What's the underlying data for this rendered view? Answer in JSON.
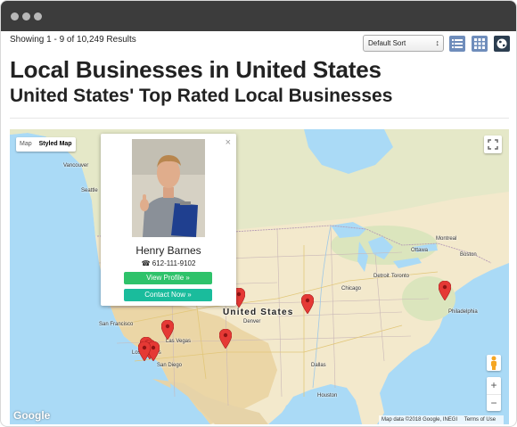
{
  "window": {
    "title_bar_dots": 3
  },
  "toolbar": {
    "results_text": "Showing 1 - 9 of 10,249 Results",
    "sort_selected": "Default Sort",
    "view_buttons": [
      "list-view",
      "grid-view",
      "map-view"
    ]
  },
  "header": {
    "title": "Local Businesses in United States",
    "subtitle": "United States' Top Rated Local Businesses"
  },
  "map": {
    "type_controls": [
      "Map",
      "Styled Map"
    ],
    "active_type": "Styled Map",
    "country_label": "United States",
    "cities": [
      "Seattle",
      "Vancouver",
      "Montreal",
      "Ottawa",
      "Toronto",
      "Boston",
      "Chicago",
      "Detroit",
      "Philadelphia",
      "San Francisco",
      "Las Vegas",
      "Los Angeles",
      "San Diego",
      "Denver",
      "Dallas",
      "Houston"
    ],
    "logo": "Google",
    "attribution": "Map data ©2018 Google, INEGI",
    "terms": "Terms of Use",
    "zoom_in": "+",
    "zoom_out": "−",
    "colors": {
      "water": "#aadaf6",
      "land": "#f5ecd4",
      "land_south": "#ecd9b0",
      "green": "#d8e6b4",
      "pin": "#e53935"
    }
  },
  "popup": {
    "name": "Henry Barnes",
    "phone": "612-111-9102",
    "profile_button": "View Profile »",
    "contact_button": "Contact Now »",
    "close": "×"
  }
}
